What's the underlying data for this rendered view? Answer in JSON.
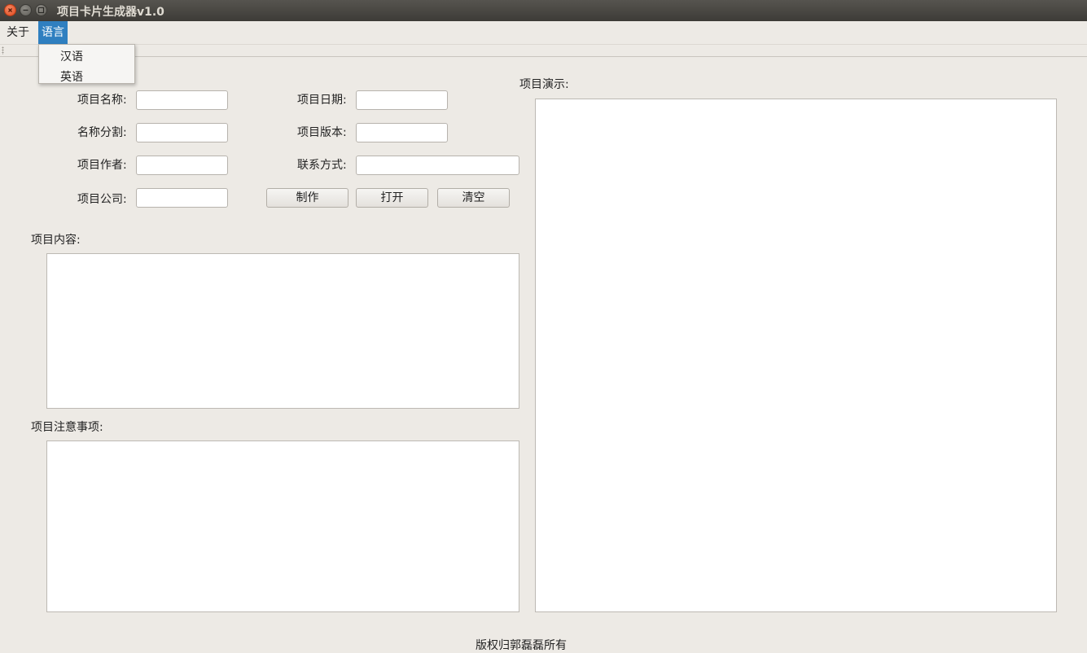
{
  "window": {
    "title": "项目卡片生成器v1.0"
  },
  "menubar": {
    "items": [
      "关于",
      "语言"
    ],
    "active_index": 1
  },
  "language_menu": {
    "items": [
      "汉语",
      "英语"
    ]
  },
  "form": {
    "project_name": {
      "label": "项目名称:",
      "value": ""
    },
    "name_split": {
      "label": "名称分割:",
      "value": ""
    },
    "project_author": {
      "label": "项目作者:",
      "value": ""
    },
    "project_company": {
      "label": "项目公司:",
      "value": ""
    },
    "project_date": {
      "label": "项目日期:",
      "value": ""
    },
    "project_version": {
      "label": "项目版本:",
      "value": ""
    },
    "contact": {
      "label": "联系方式:",
      "value": ""
    }
  },
  "buttons": {
    "make": "制作",
    "open": "打开",
    "clear": "清空"
  },
  "content": {
    "label": "项目内容:",
    "value": ""
  },
  "notes": {
    "label": "项目注意事项:",
    "value": ""
  },
  "preview": {
    "label": "项目演示:"
  },
  "footer": {
    "text": "版权归郭磊磊所有"
  },
  "colors": {
    "menu_active": "#2f7fc0",
    "window_bg": "#edeae5",
    "close_button": "#e0471e"
  }
}
